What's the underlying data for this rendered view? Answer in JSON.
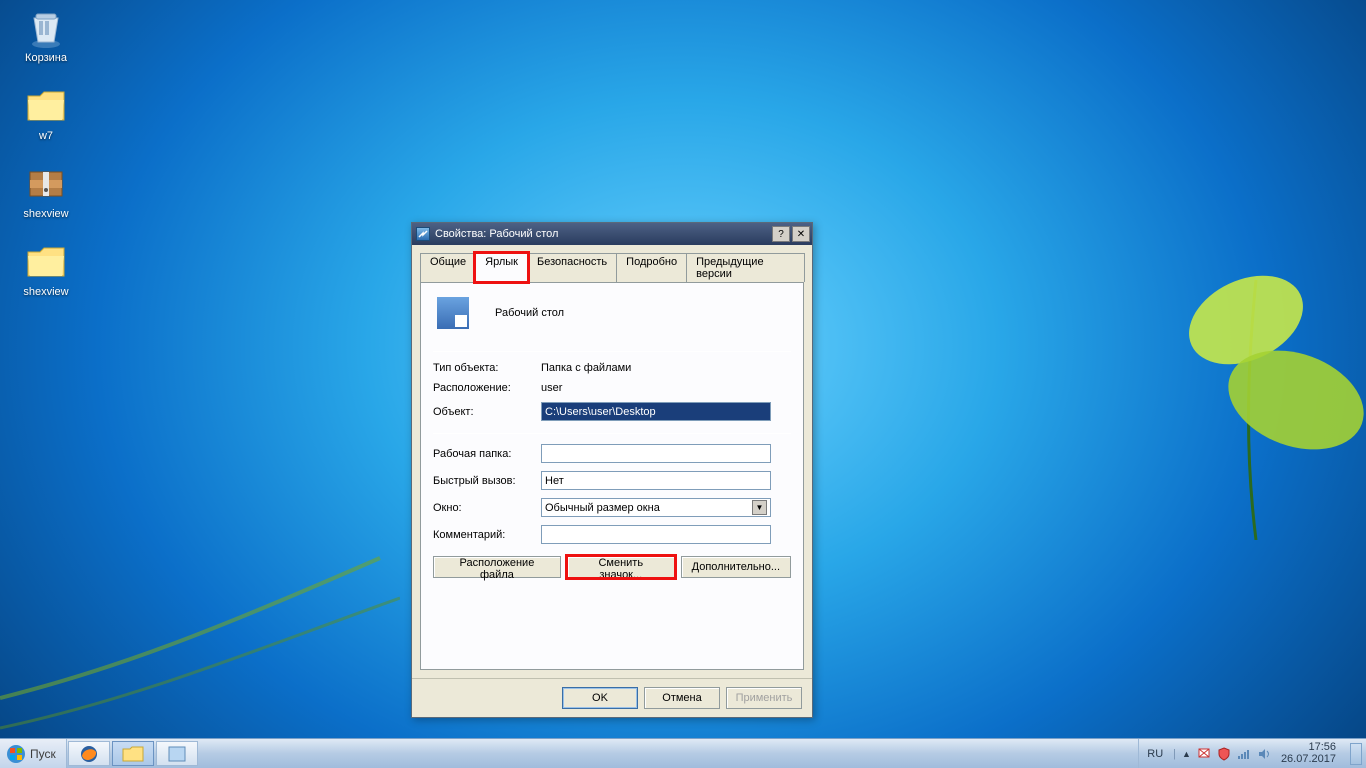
{
  "desktopIcons": [
    {
      "name": "recycle-bin",
      "label": "Корзина"
    },
    {
      "name": "folder-w7",
      "label": "w7"
    },
    {
      "name": "shexview-archive",
      "label": "shexview"
    },
    {
      "name": "shexview-folder",
      "label": "shexview"
    }
  ],
  "dialog": {
    "title": "Свойства: Рабочий стол",
    "tabs": [
      "Общие",
      "Ярлык",
      "Безопасность",
      "Подробно",
      "Предыдущие версии"
    ],
    "shortcutName": "Рабочий стол",
    "fields": {
      "typeLabel": "Тип объекта:",
      "typeValue": "Папка с файлами",
      "locationLabel": "Расположение:",
      "locationValue": "user",
      "targetLabel": "Объект:",
      "targetValue": "C:\\Users\\user\\Desktop",
      "startInLabel": "Рабочая папка:",
      "startInValue": "",
      "shortcutKeyLabel": "Быстрый вызов:",
      "shortcutKeyValue": "Нет",
      "runLabel": "Окно:",
      "runValue": "Обычный размер окна",
      "commentLabel": "Комментарий:",
      "commentValue": ""
    },
    "buttons": {
      "openLocation": "Расположение файла",
      "changeIcon": "Сменить значок...",
      "advanced": "Дополнительно..."
    },
    "dlgButtons": {
      "ok": "OK",
      "cancel": "Отмена",
      "apply": "Применить"
    }
  },
  "taskbar": {
    "start": "Пуск",
    "lang": "RU",
    "time": "17:56",
    "date": "26.07.2017"
  }
}
